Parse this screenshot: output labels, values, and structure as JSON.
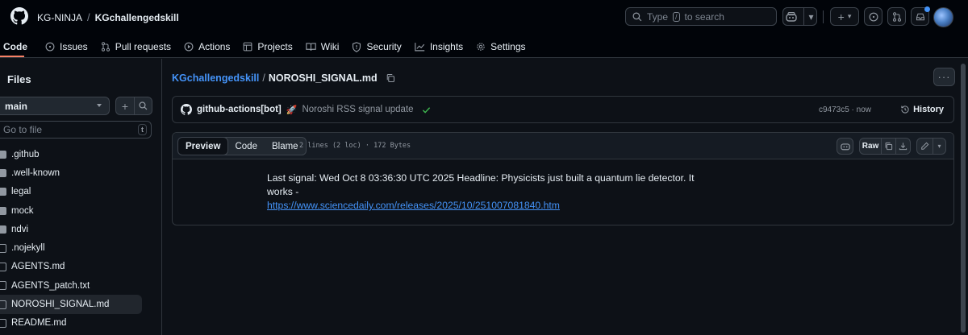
{
  "header": {
    "owner": "KG-NINJA",
    "separator": "/",
    "repo": "KGchallengedskill",
    "search_placeholder": "Type",
    "search_key": "/",
    "search_suffix": "to search"
  },
  "nav": {
    "tabs": [
      {
        "label": "Code",
        "icon": "code-icon"
      },
      {
        "label": "Issues",
        "icon": "issue-icon"
      },
      {
        "label": "Pull requests",
        "icon": "pull-request-icon"
      },
      {
        "label": "Actions",
        "icon": "play-icon"
      },
      {
        "label": "Projects",
        "icon": "table-icon"
      },
      {
        "label": "Wiki",
        "icon": "book-icon"
      },
      {
        "label": "Security",
        "icon": "shield-icon"
      },
      {
        "label": "Insights",
        "icon": "graph-icon"
      },
      {
        "label": "Settings",
        "icon": "gear-icon"
      }
    ]
  },
  "sidebar": {
    "title": "Files",
    "branch": "main",
    "goto_placeholder": "Go to file",
    "goto_key": "t",
    "items": [
      {
        "name": ".github",
        "type": "folder"
      },
      {
        "name": ".well-known",
        "type": "folder"
      },
      {
        "name": "legal",
        "type": "folder"
      },
      {
        "name": "mock",
        "type": "folder"
      },
      {
        "name": "ndvi",
        "type": "folder"
      },
      {
        "name": ".nojekyll",
        "type": "file"
      },
      {
        "name": "AGENTS.md",
        "type": "file"
      },
      {
        "name": "AGENTS_patch.txt",
        "type": "file"
      },
      {
        "name": "NOROSHI_SIGNAL.md",
        "type": "file",
        "selected": true
      },
      {
        "name": "README.md",
        "type": "file"
      }
    ]
  },
  "main": {
    "breadcrumb_repo": "KGchallengedskill",
    "breadcrumb_sep": "/",
    "breadcrumb_file": "NOROSHI_SIGNAL.md",
    "commit": {
      "author": "github-actions[bot]",
      "emoji": "🚀",
      "message": "Noroshi RSS signal update",
      "meta": "c9473c5 · now",
      "history_label": "History"
    },
    "file": {
      "tabs": [
        "Preview",
        "Code",
        "Blame"
      ],
      "info": "2 lines (2 loc) · 172 Bytes",
      "raw_label": "Raw",
      "text": "Last signal: Wed Oct 8 03:36:30 UTC 2025 Headline: Physicists just built a quantum lie detector. It works -",
      "link": "https://www.sciencedaily.com/releases/2025/10/251007081840.htm"
    }
  },
  "colors": {
    "background": "#0d1117",
    "header_bg": "#010409",
    "accent_link": "#4493f8",
    "active_tab_underline": "#f78166",
    "success": "#3fb950"
  }
}
